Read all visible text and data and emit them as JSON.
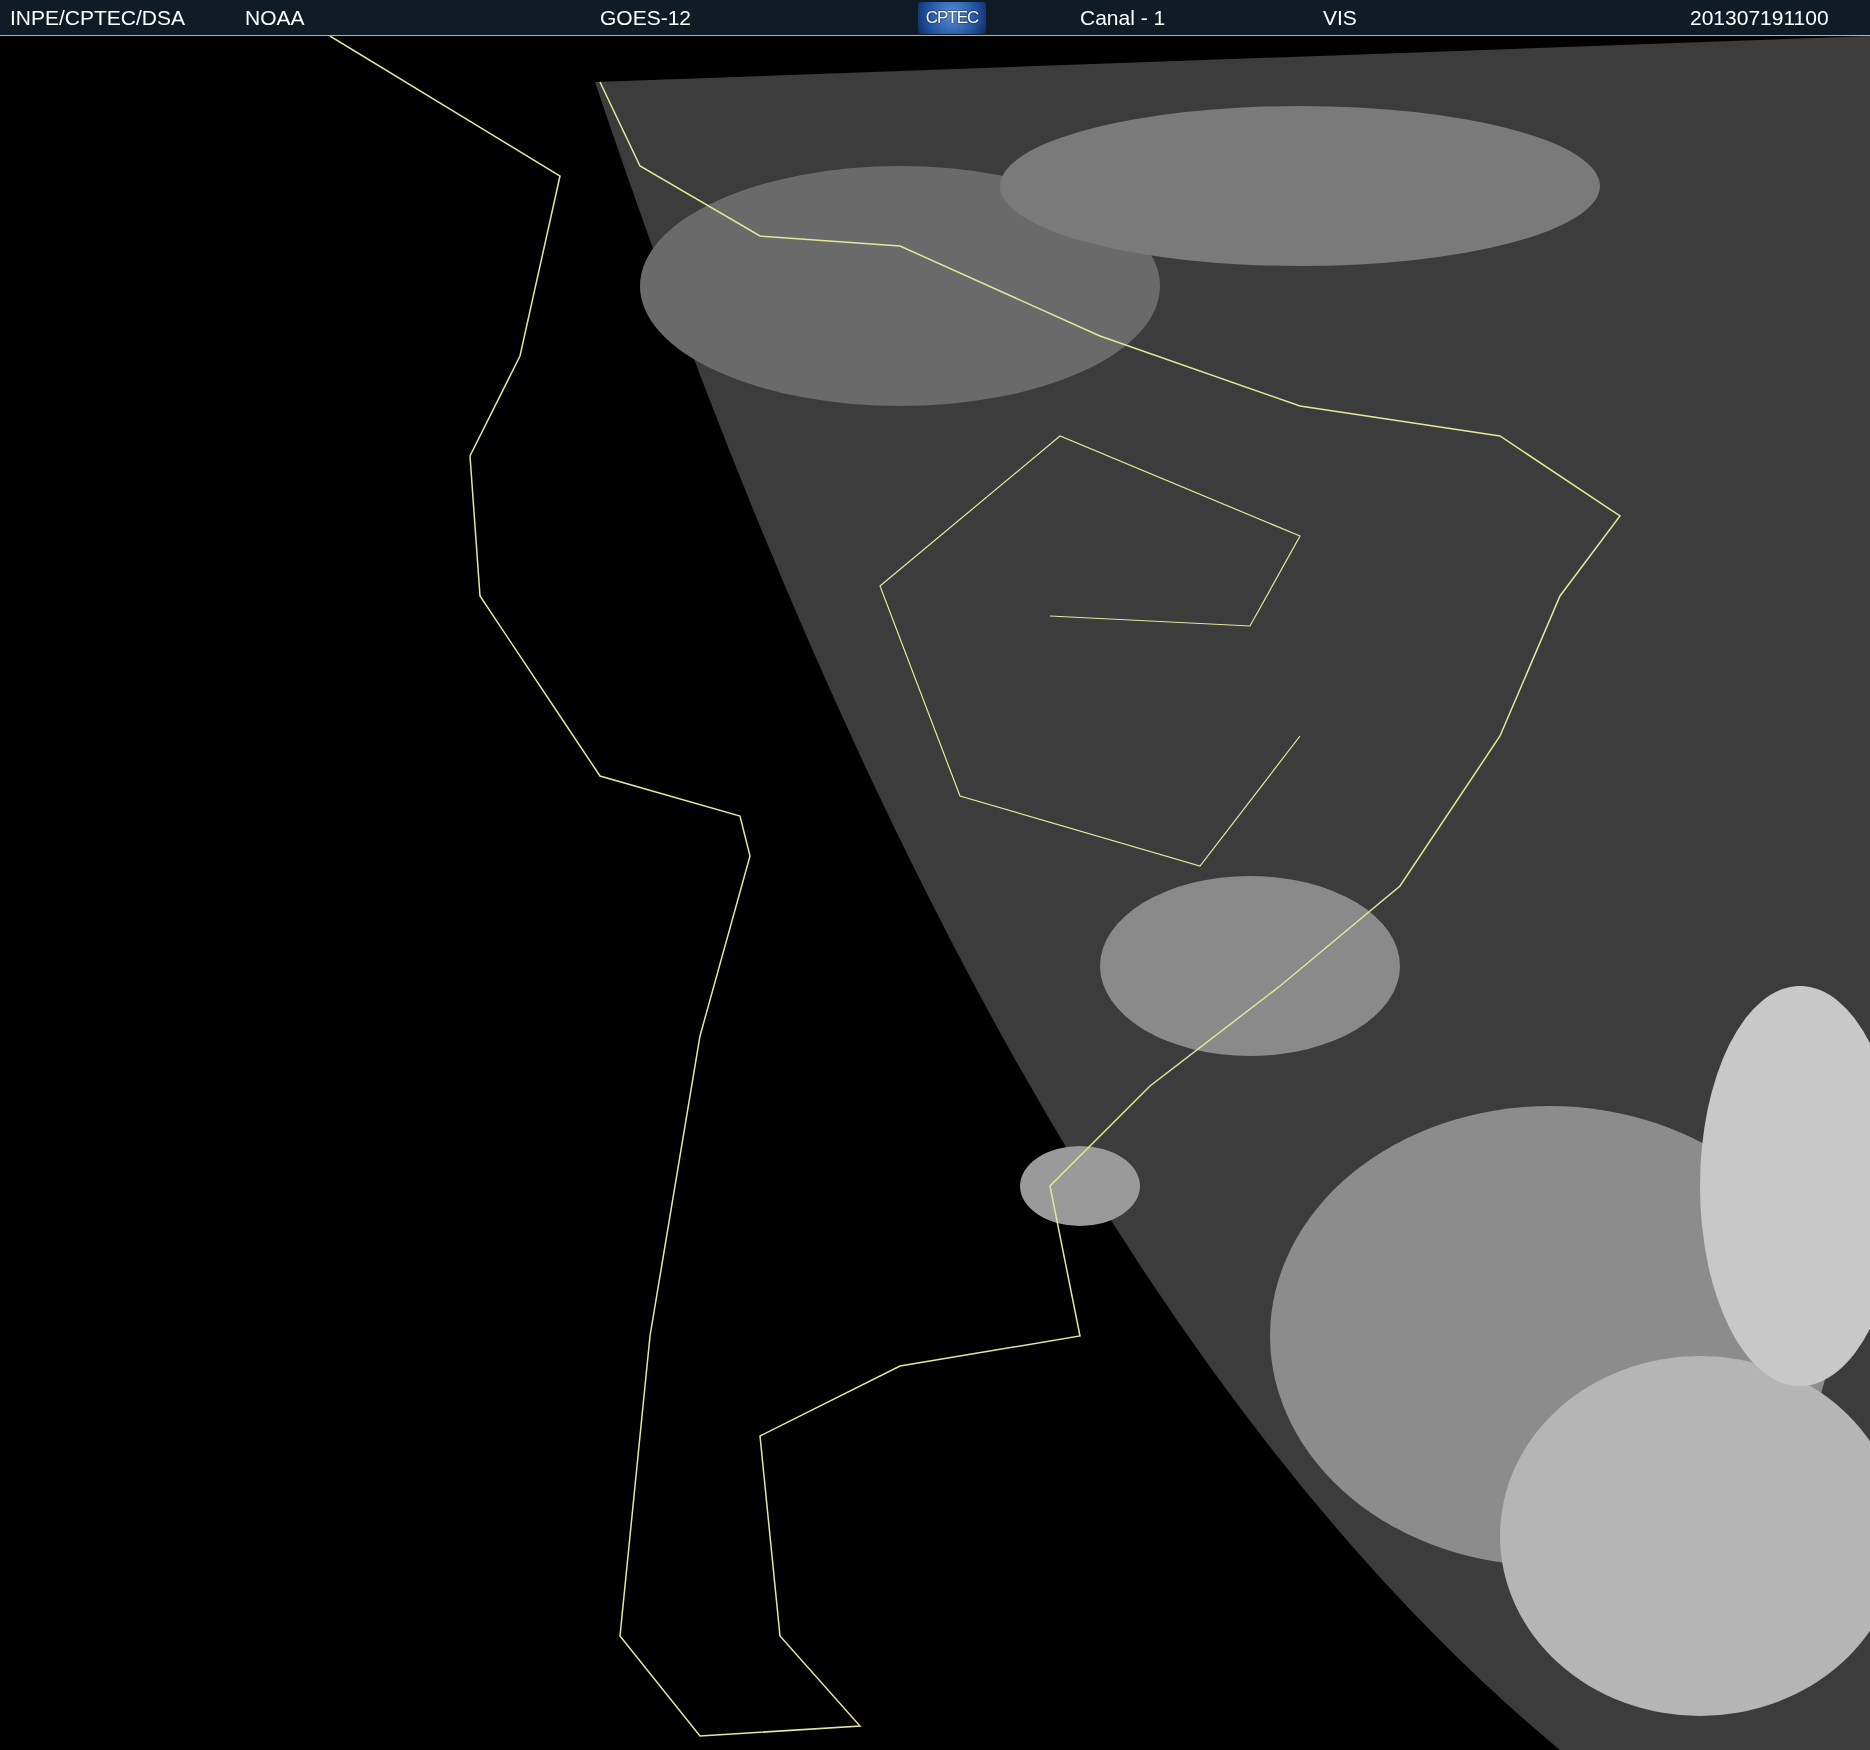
{
  "header": {
    "agency": "INPE/CPTEC/DSA",
    "source": "NOAA",
    "satellite": "GOES-12",
    "logo": "CPTEC",
    "channel": "Canal - 1",
    "band": "VIS",
    "timestamp": "201307191100"
  }
}
